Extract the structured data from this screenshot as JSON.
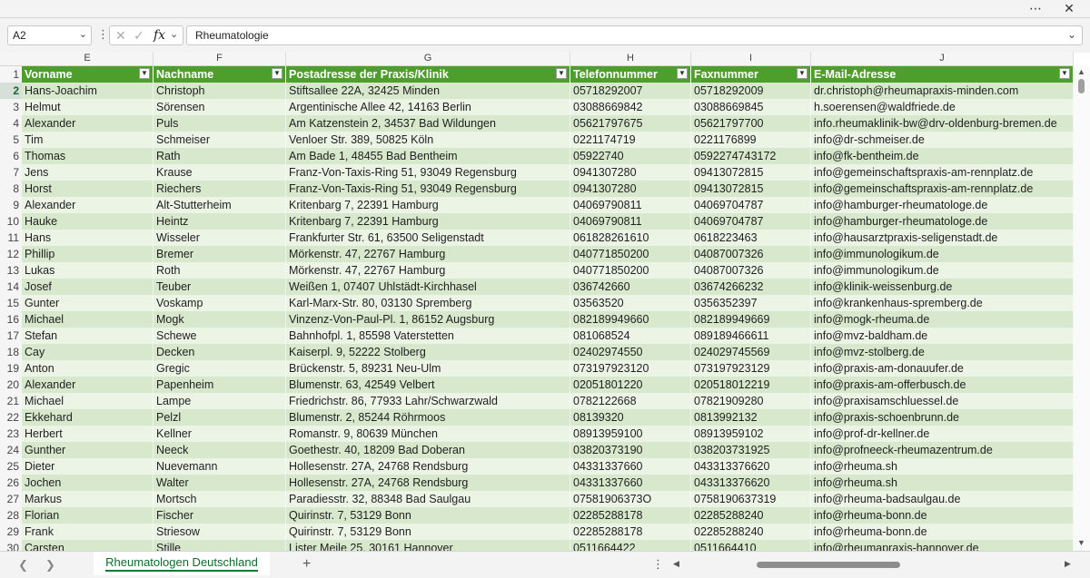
{
  "window": {
    "more_icon": "ellipsis-icon",
    "close_icon": "close-icon"
  },
  "formula_bar": {
    "cell_ref": "A2",
    "formula_value": "Rheumatologie"
  },
  "columns": [
    "E",
    "F",
    "G",
    "H",
    "I",
    "J"
  ],
  "table": {
    "headers": [
      "Vorname",
      "Nachname",
      "Postadresse der Praxis/Klinik",
      "Telefonnummer",
      "Faxnummer",
      "E-Mail-Adresse"
    ],
    "rows": [
      [
        "2",
        "Hans-Joachim",
        "Christoph",
        "Stiftsallee 22A, 32425 Minden",
        "05718292007",
        "05718292009",
        "dr.christoph@rheumapraxis-minden.com"
      ],
      [
        "3",
        "Helmut",
        "Sörensen",
        "Argentinische Allee 42, 14163 Berlin",
        "03088669842",
        "03088669845",
        "h.soerensen@waldfriede.de"
      ],
      [
        "4",
        "Alexander",
        "Puls",
        "Am Katzenstein 2, 34537 Bad Wildungen",
        "05621797675",
        "05621797700",
        "info.rheumaklinik-bw@drv-oldenburg-bremen.de"
      ],
      [
        "5",
        "Tim",
        "Schmeiser",
        "Venloer Str. 389, 50825 Köln",
        "0221174719",
        "0221176899",
        "info@dr-schmeiser.de"
      ],
      [
        "6",
        "Thomas",
        "Rath",
        "Am Bade 1, 48455 Bad Bentheim",
        "05922740",
        "0592274743172",
        "info@fk-bentheim.de"
      ],
      [
        "7",
        "Jens",
        "Krause",
        "Franz-Von-Taxis-Ring 51, 93049 Regensburg",
        "0941307280",
        "09413072815",
        "info@gemeinschaftspraxis-am-rennplatz.de"
      ],
      [
        "8",
        "Horst",
        "Riechers",
        "Franz-Von-Taxis-Ring 51, 93049 Regensburg",
        "0941307280",
        "09413072815",
        "info@gemeinschaftspraxis-am-rennplatz.de"
      ],
      [
        "9",
        "Alexander",
        "Alt-Stutterheim",
        "Kritenbarg 7, 22391 Hamburg",
        "04069790811",
        "04069704787",
        "info@hamburger-rheumatologe.de"
      ],
      [
        "10",
        "Hauke",
        "Heintz",
        "Kritenbarg 7, 22391 Hamburg",
        "04069790811",
        "04069704787",
        "info@hamburger-rheumatologe.de"
      ],
      [
        "11",
        "Hans",
        "Wisseler",
        "Frankfurter Str. 61, 63500 Seligenstadt",
        "061828261610",
        "0618223463",
        "info@hausarztpraxis-seligenstadt.de"
      ],
      [
        "12",
        "Phillip",
        "Bremer",
        "Mörkenstr. 47, 22767 Hamburg",
        "040771850200",
        "04087007326",
        "info@immunologikum.de"
      ],
      [
        "13",
        "Lukas",
        "Roth",
        "Mörkenstr. 47, 22767 Hamburg",
        "040771850200",
        "04087007326",
        "info@immunologikum.de"
      ],
      [
        "14",
        "Josef",
        "Teuber",
        "Weißen 1, 07407 Uhlstädt-Kirchhasel",
        "036742660",
        "03674266232",
        "info@klinik-weissenburg.de"
      ],
      [
        "15",
        "Gunter",
        "Voskamp",
        "Karl-Marx-Str. 80, 03130 Spremberg",
        "03563520",
        "0356352397",
        "info@krankenhaus-spremberg.de"
      ],
      [
        "16",
        "Michael",
        "Mogk",
        "Vinzenz-Von-Paul-Pl. 1, 86152 Augsburg",
        "082189949660",
        "082189949669",
        "info@mogk-rheuma.de"
      ],
      [
        "17",
        "Stefan",
        "Schewe",
        "Bahnhofpl. 1, 85598 Vaterstetten",
        "081068524",
        "089189466611",
        "info@mvz-baldham.de"
      ],
      [
        "18",
        "Cay",
        "Decken",
        "Kaiserpl. 9, 52222 Stolberg",
        "02402974550",
        "024029745569",
        "info@mvz-stolberg.de"
      ],
      [
        "19",
        "Anton",
        "Gregic",
        "Brückenstr. 5, 89231 Neu-Ulm",
        "073197923120",
        "073197923129",
        "info@praxis-am-donauufer.de"
      ],
      [
        "20",
        "Alexander",
        "Papenheim",
        "Blumenstr. 63, 42549 Velbert",
        "02051801220",
        "020518012219",
        "info@praxis-am-offerbusch.de"
      ],
      [
        "21",
        "Michael",
        "Lampe",
        "Friedrichstr. 86, 77933 Lahr/Schwarzwald",
        "0782122668",
        "07821909280",
        "info@praxisamschluessel.de"
      ],
      [
        "22",
        "Ekkehard",
        "Pelzl",
        "Blumenstr. 2, 85244 Röhrmoos",
        "08139320",
        "0813992132",
        "info@praxis-schoenbrunn.de"
      ],
      [
        "23",
        "Herbert",
        "Kellner",
        "Romanstr. 9, 80639 München",
        "08913959100",
        "08913959102",
        "info@prof-dr-kellner.de"
      ],
      [
        "24",
        "Gunther",
        "Neeck",
        "Goethestr. 40, 18209 Bad Doberan",
        "03820373190",
        "038203731925",
        "info@profneeck-rheumazentrum.de"
      ],
      [
        "25",
        "Dieter",
        "Nuevemann",
        "Hollesenstr. 27A, 24768 Rendsburg",
        "04331337660",
        "043313376620",
        "info@rheuma.sh"
      ],
      [
        "26",
        "Jochen",
        "Walter",
        "Hollesenstr. 27A, 24768 Rendsburg",
        "04331337660",
        "043313376620",
        "info@rheuma.sh"
      ],
      [
        "27",
        "Markus",
        "Mortsch",
        "Paradiesstr. 32, 88348 Bad Saulgau",
        "07581906373O",
        "0758190637319",
        "info@rheuma-badsaulgau.de"
      ],
      [
        "28",
        "Florian",
        "Fischer",
        "Quirinstr. 7, 53129 Bonn",
        "02285288178",
        "02285288240",
        "info@rheuma-bonn.de"
      ],
      [
        "29",
        "Frank",
        "Striesow",
        "Quirinstr. 7, 53129 Bonn",
        "02285288178",
        "02285288240",
        "info@rheuma-bonn.de"
      ],
      [
        "30",
        "Carsten",
        "Stille",
        "Lister Meile 25, 30161 Hannover",
        "0511664422",
        "0511664410",
        "info@rheumapraxis-hannover.de"
      ]
    ]
  },
  "sheet_tab": {
    "label": "Rheumatologen Deutschland"
  },
  "colors": {
    "header_green": "#4d9e2b",
    "band_dark": "#d8e8cc",
    "band_light": "#ecf4e6",
    "accent": "#117a33"
  }
}
